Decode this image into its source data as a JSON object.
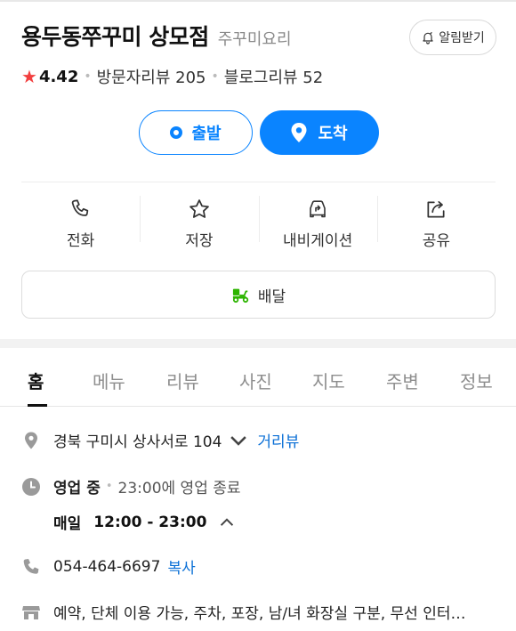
{
  "header": {
    "place_name": "용두동쭈꾸미 상모점",
    "category": "주꾸미요리",
    "alarm_label": "알림받기"
  },
  "rating": {
    "star": "★",
    "score": "4.42",
    "visitor_reviews": "방문자리뷰 205",
    "blog_reviews": "블로그리뷰 52"
  },
  "route": {
    "depart_label": "출발",
    "arrive_label": "도착"
  },
  "actions": [
    {
      "label": "전화",
      "icon": "phone-icon"
    },
    {
      "label": "저장",
      "icon": "star-outline-icon"
    },
    {
      "label": "내비게이션",
      "icon": "car-navigation-icon"
    },
    {
      "label": "공유",
      "icon": "share-icon"
    }
  ],
  "delivery": {
    "label": "배달",
    "icon": "delivery-scooter-icon"
  },
  "tabs": [
    {
      "label": "홈",
      "active": true
    },
    {
      "label": "메뉴"
    },
    {
      "label": "리뷰"
    },
    {
      "label": "사진"
    },
    {
      "label": "지도"
    },
    {
      "label": "주변"
    },
    {
      "label": "정보"
    }
  ],
  "info": {
    "address": "경북 구미시 상사서로 104",
    "street_view": "거리뷰",
    "status": "영업 중",
    "closing": "23:00에 영업 종료",
    "days": "매일",
    "hours": "12:00 - 23:00",
    "phone": "054-464-6697",
    "copy": "복사",
    "amenities": "예약, 단체 이용 가능, 주차, 포장, 남/녀 화장실 구분, 무선 인터…"
  },
  "colors": {
    "accent": "#0a84ff",
    "star": "#f23f3f",
    "delivery_icon": "#2db400",
    "link": "#0a6fd6"
  }
}
